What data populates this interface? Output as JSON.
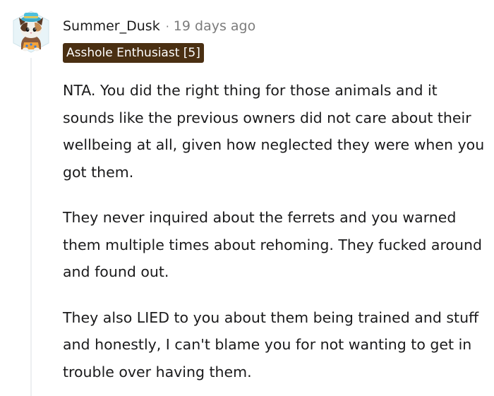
{
  "comment": {
    "username": "Summer_Dusk",
    "separator": "·",
    "timestamp": "19 days ago",
    "flair": "Asshole Enthusiast [5]",
    "avatar_icon": "snoo-cat-avatar-icon",
    "paragraphs": [
      "NTA. You did the right thing for those animals and it sounds like the previous owners did not care about their wellbeing at all, given how neglected they were when you got them.",
      "They never inquired about the ferrets and you warned them multiple times about rehoming. They fucked around and found out.",
      "They also LIED to you about them being trained and stuff and honestly, I can't blame you for not wanting to get in trouble over having them."
    ]
  },
  "colors": {
    "flair_background": "#4a2f12",
    "flair_text": "#ffffff",
    "meta_gray": "#7c7c7c",
    "thread_line": "#edeff1",
    "body_text": "#1a1a1b"
  }
}
